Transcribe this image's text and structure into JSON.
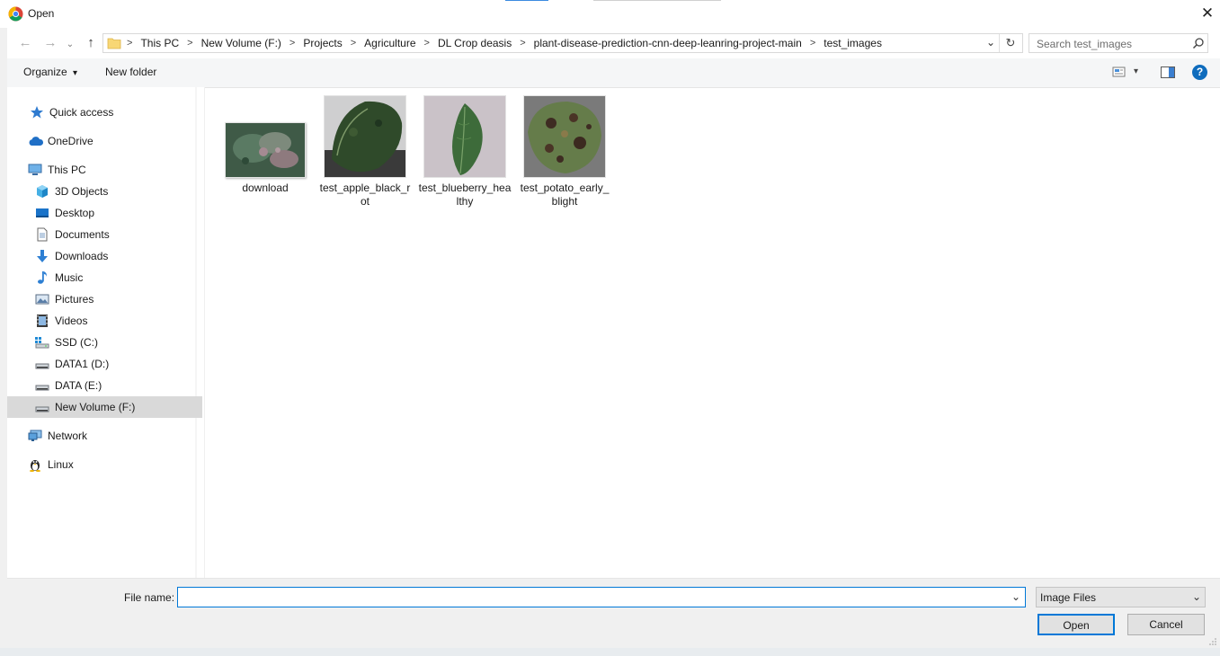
{
  "window": {
    "title": "Open",
    "close_glyph": "✕"
  },
  "nav": {
    "back_glyph": "←",
    "forward_glyph": "→",
    "up_glyph": "↑",
    "recent_glyph": "⌄",
    "refresh_glyph": "↻",
    "breadcrumb": [
      "This PC",
      "New Volume (F:)",
      "Projects",
      "Agriculture",
      "DL Crop deasis",
      "plant-disease-prediction-cnn-deep-leanring-project-main",
      "test_images"
    ],
    "crumb_sep": ">",
    "dropdown_glyph": "⌄"
  },
  "search": {
    "placeholder": "Search test_images"
  },
  "toolbar": {
    "organize_label": "Organize",
    "organize_caret": "▾",
    "new_folder_label": "New folder",
    "view_caret": "▾",
    "help_glyph": "?"
  },
  "sidebar": {
    "items": [
      {
        "label": "Quick access",
        "icon": "star-icon"
      },
      {
        "label": "OneDrive",
        "icon": "cloud-icon"
      },
      {
        "label": "This PC",
        "icon": "computer-icon"
      },
      {
        "label": "3D Objects",
        "icon": "cube-icon"
      },
      {
        "label": "Desktop",
        "icon": "desktop-icon"
      },
      {
        "label": "Documents",
        "icon": "document-icon"
      },
      {
        "label": "Downloads",
        "icon": "download-icon"
      },
      {
        "label": "Music",
        "icon": "music-icon"
      },
      {
        "label": "Pictures",
        "icon": "pictures-icon"
      },
      {
        "label": "Videos",
        "icon": "video-icon"
      },
      {
        "label": "SSD (C:)",
        "icon": "drive-icon"
      },
      {
        "label": "DATA1 (D:)",
        "icon": "drive-icon"
      },
      {
        "label": "DATA (E:)",
        "icon": "drive-icon"
      },
      {
        "label": "New Volume (F:)",
        "icon": "drive-icon",
        "selected": true
      },
      {
        "label": "Network",
        "icon": "network-icon"
      },
      {
        "label": "Linux",
        "icon": "linux-icon"
      }
    ]
  },
  "files": [
    {
      "label": "download"
    },
    {
      "label": "test_apple_black_rot"
    },
    {
      "label": "test_blueberry_healthy"
    },
    {
      "label": "test_potato_early_blight"
    }
  ],
  "bottom": {
    "file_name_label": "File name:",
    "file_name_value": "",
    "file_type_value": "Image Files",
    "open_label": "Open",
    "cancel_label": "Cancel",
    "dropdown_glyph": "⌄"
  },
  "colors": {
    "accent": "#0078d7",
    "selection": "#d9d9d9",
    "help_blue": "#0f6cbd"
  }
}
